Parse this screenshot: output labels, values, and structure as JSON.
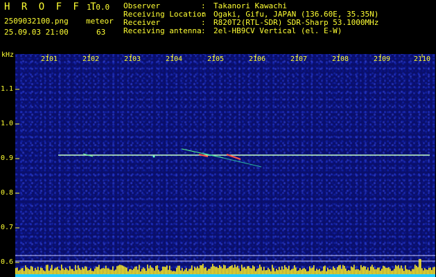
{
  "header": {
    "app_title": "H R O F F T",
    "version": "1.0.0",
    "filename": "2509032100.png",
    "timestamp": "25.09.03 21:00",
    "meteor_label": "meteor",
    "meteor_count": "63",
    "info": [
      {
        "label": "Observer",
        "sep": ":",
        "value": "Takanori Kawachi"
      },
      {
        "label": "Receiving Location",
        "sep": ":",
        "value": "Ogaki, Gifu, JAPAN (136.60E, 35.35N)"
      },
      {
        "label": "Receiver",
        "sep": ":",
        "value": "R820T2(RTL-SDR) SDR-Sharp 53.1000MHz"
      },
      {
        "label": "Receiving antenna",
        "sep": ":",
        "value": "2el-HB9CV Vertical (el. E-W)"
      }
    ]
  },
  "axes": {
    "y_unit": "kHz",
    "y_ticks": [
      "1.1",
      "1.0",
      "0.9",
      "0.8",
      "0.7",
      "0.6"
    ],
    "x_ticks": [
      "2101",
      "2102",
      "2103",
      "2104",
      "2105",
      "2106",
      "2107",
      "2108",
      "2109",
      "2110"
    ]
  },
  "colors": {
    "text": "#ffff33",
    "background": "#0a0f6a",
    "carrier": "#b8ffb0",
    "histogram": "#ffee22",
    "baseline": "#22ccff"
  }
}
